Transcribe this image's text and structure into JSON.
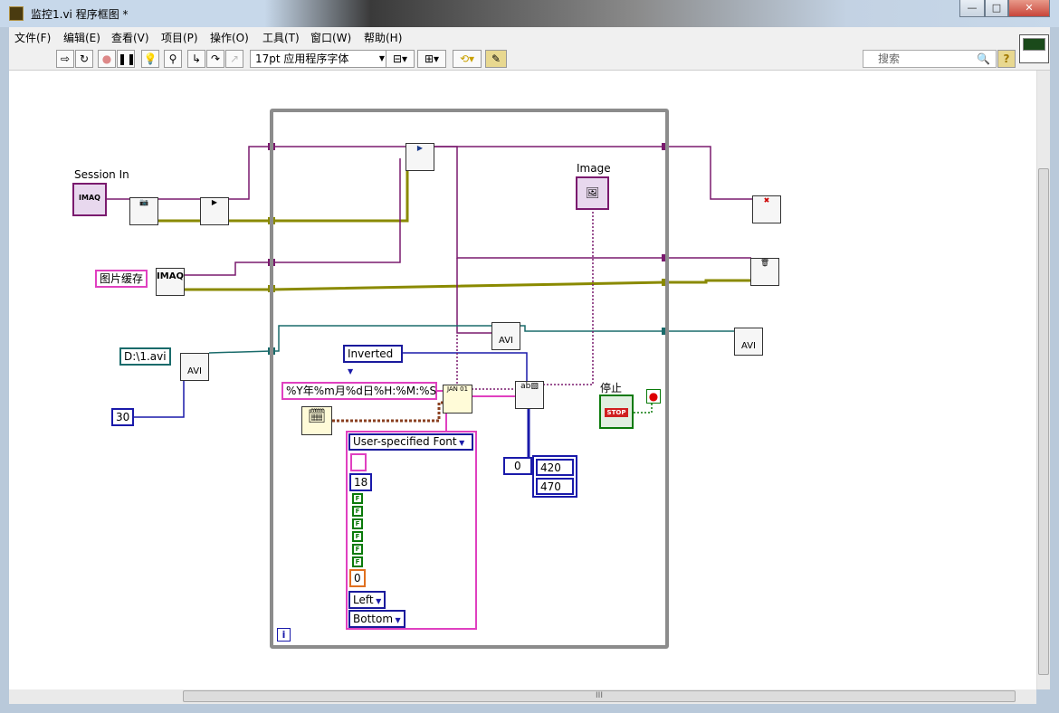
{
  "window": {
    "title": "监控1.vi 程序框图 *",
    "minimize": "—",
    "maximize": "□",
    "close": "✕"
  },
  "menu": [
    "文件(F)",
    "编辑(E)",
    "查看(V)",
    "项目(P)",
    "操作(O)",
    "工具(T)",
    "窗口(W)",
    "帮助(H)"
  ],
  "toolbar": {
    "font": "17pt 应用程序字体",
    "search_placeholder": "搜索",
    "help": "?"
  },
  "diagram": {
    "session_in_label": "Session In",
    "imaq_label": "IMAQ",
    "image_buffer_name": "图片缓存",
    "avi_path": "D:\\1.avi",
    "frame_rate": "30",
    "image_label": "Image",
    "avi_text": "AVI",
    "text_mode": "Inverted",
    "date_format": "%Y年%m月%d日%H:%M:%S",
    "font_option": "User-specified Font",
    "font_size": "18",
    "bool_flags": [
      "F",
      "F",
      "F",
      "F",
      "F",
      "F"
    ],
    "font_num": "0",
    "align_h": "Left",
    "align_v": "Bottom",
    "index_value": "0",
    "origin_x": "420",
    "origin_y": "470",
    "stop_label": "停止",
    "stop_text": "STOP",
    "loop_iteration": "i"
  },
  "hscroll_grip": "III"
}
